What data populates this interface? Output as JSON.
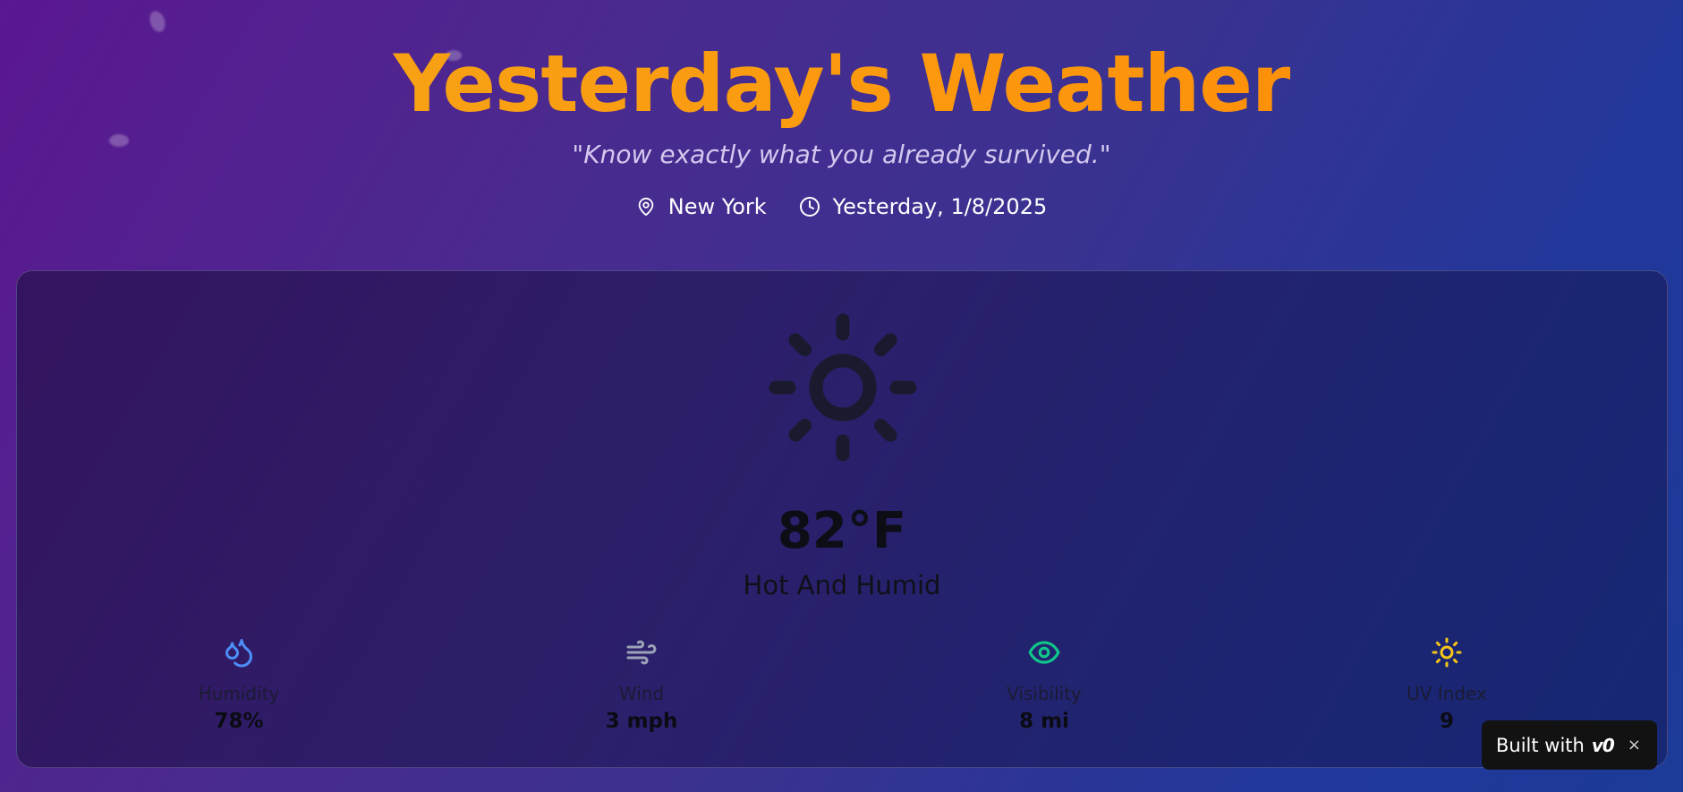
{
  "header": {
    "title": "Yesterday's Weather",
    "tagline": "\"Know exactly what you already survived.\"",
    "location": "New York",
    "date": "Yesterday, 1/8/2025"
  },
  "weather": {
    "icon": "sun-icon",
    "temperature": "82°F",
    "condition": "Hot And Humid"
  },
  "stats": [
    {
      "icon": "droplets-icon",
      "label": "Humidity",
      "value": "78%",
      "color": "#4d8ef7"
    },
    {
      "icon": "wind-icon",
      "label": "Wind",
      "value": "3 mph",
      "color": "#9ca3b8"
    },
    {
      "icon": "eye-icon",
      "label": "Visibility",
      "value": "8 mi",
      "color": "#10c78a"
    },
    {
      "icon": "sun-icon",
      "label": "UV Index",
      "value": "9",
      "color": "#f5c518"
    }
  ],
  "badge": {
    "text": "Built with",
    "logo": "v0",
    "close": "×"
  },
  "colors": {
    "title_gradient_start": "#f4a718",
    "title_gradient_end": "#ff8a05",
    "background_start": "#5b1790",
    "background_end": "#1c3a98"
  }
}
